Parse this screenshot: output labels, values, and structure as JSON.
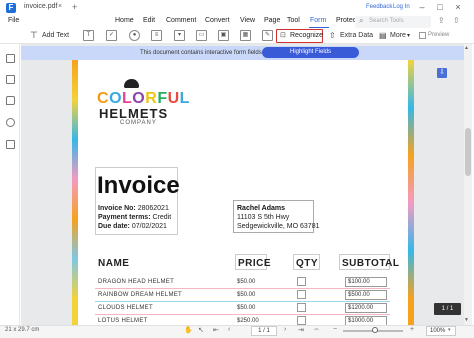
{
  "window": {
    "file_name": "invoice.pdf",
    "feedback": "Feedback",
    "login": "Log In"
  },
  "menu": {
    "file": "File",
    "items": [
      "Home",
      "Edit",
      "Comment",
      "Convert",
      "View",
      "Page",
      "Tool",
      "Form",
      "Protect"
    ],
    "active": "Form",
    "search_placeholder": "Search Tools"
  },
  "toolbar": {
    "add_text": "Add Text",
    "recognize": "Recognize",
    "extra_data": "Extra Data",
    "more": "More",
    "preview": "Preview"
  },
  "notice": {
    "text": "This document contains interactive form fields.",
    "button": "Highlight Fields"
  },
  "document": {
    "logo": {
      "colorful": "COLORFUL",
      "helmets": "HELMETS",
      "company": "COMPANY"
    },
    "invoice_title": "Invoice",
    "invoice_no_label": "Invoice No:",
    "invoice_no": "28062021",
    "payment_terms_label": "Payment terms:",
    "payment_terms": "Credit",
    "due_date_label": "Due date:",
    "due_date": "07/02/2021",
    "bill_to": {
      "name": "Rachel Adams",
      "address1": "11103 S 5th Hwy",
      "address2": "Sedgewickville, MO 63781"
    },
    "columns": {
      "name": "NAME",
      "price": "PRICE",
      "qty": "QTY",
      "subtotal": "SUBTOTAL"
    },
    "rows": [
      {
        "name": "DRAGON HEAD HELMET",
        "price": "$50.00",
        "subtotal": "$100.00"
      },
      {
        "name": "RAINBOW DREAM HELMET",
        "price": "$50.00",
        "subtotal": "$500.00"
      },
      {
        "name": "CLOUDS HELMET",
        "price": "$50.00",
        "subtotal": "$1200.00"
      },
      {
        "name": "LOTUS HELMET",
        "price": "$250.00",
        "subtotal": "$1000.00"
      }
    ]
  },
  "page_counter": "1 / 1",
  "status": {
    "dimensions": "21 x 29.7 cm",
    "page": "1 / 1",
    "zoom": "100%"
  }
}
